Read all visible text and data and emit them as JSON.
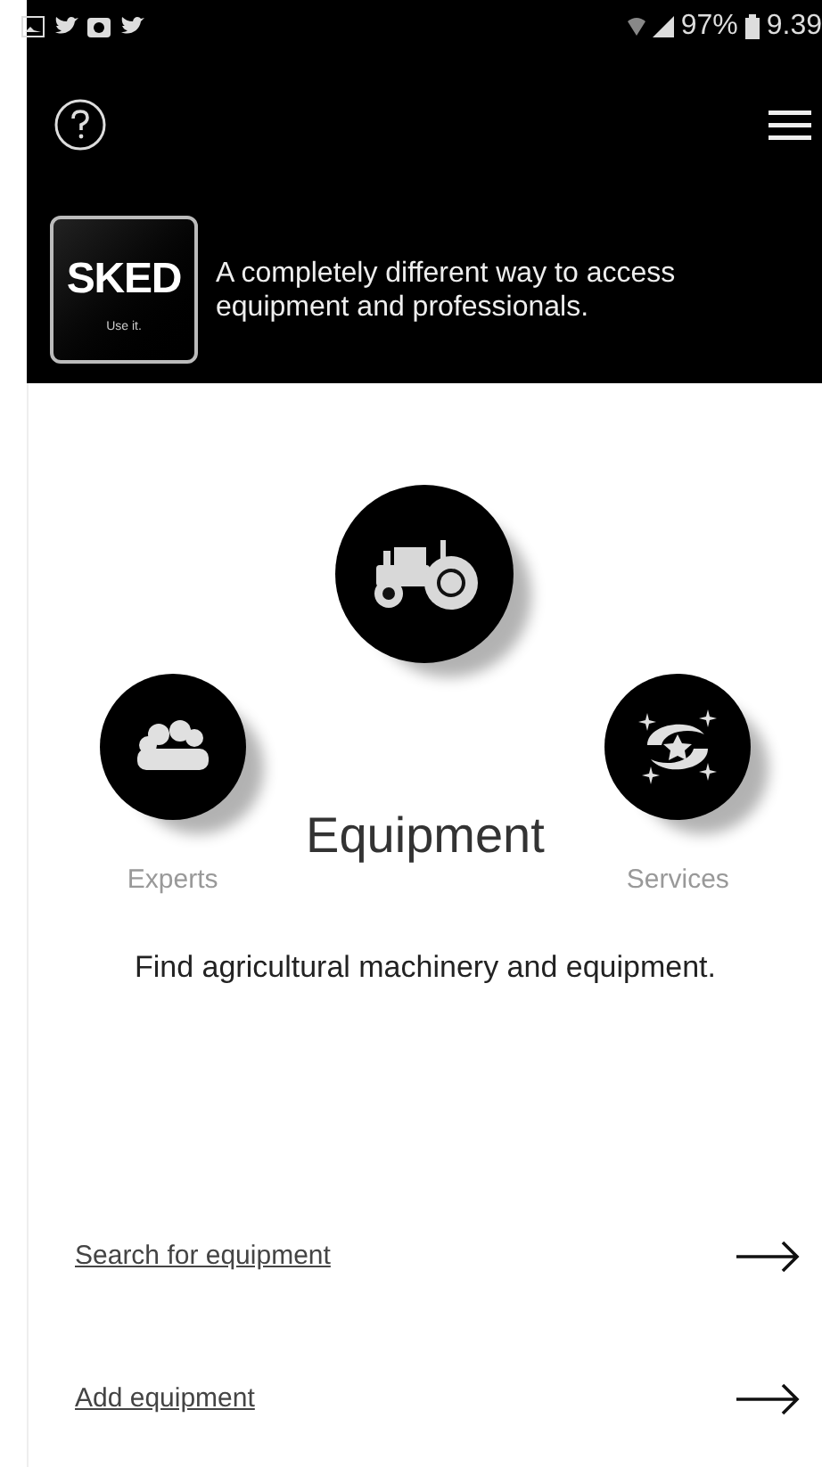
{
  "status_bar": {
    "battery": "97%",
    "time": "9.39"
  },
  "header": {
    "logo": {
      "name": "SKED",
      "tagline": "Use it."
    },
    "slogan": "A completely different way to access equipment and professionals."
  },
  "categories": [
    {
      "label": "Experts",
      "kind": "people",
      "selected": false
    },
    {
      "label": "Equipment",
      "kind": "tractor",
      "selected": true
    },
    {
      "label": "Services",
      "kind": "stars",
      "selected": false
    }
  ],
  "description": "Find agricultural machinery and equipment.",
  "links": [
    {
      "label": "Search for equipment"
    },
    {
      "label": "Add equipment"
    }
  ]
}
